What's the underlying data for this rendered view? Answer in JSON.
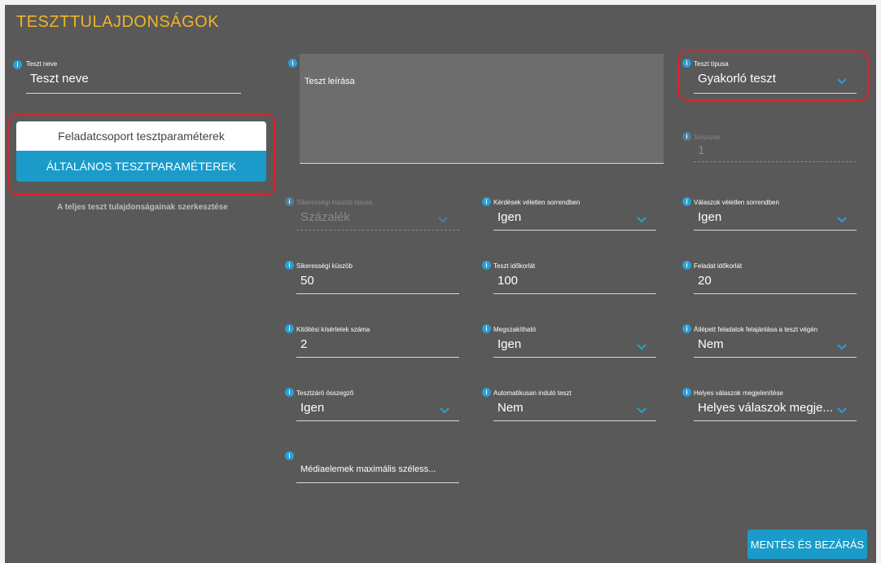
{
  "page": {
    "title": "TESZTTULAJDONSÁGOK"
  },
  "left": {
    "name_label": "Teszt neve",
    "name_value": "Teszt neve",
    "btn_group_params": "Feladatcsoport tesztparaméterek",
    "btn_general_params": "ÁLTALÁNOS TESZTPARAMÉTEREK",
    "caption": "A teljes teszt tulajdonságainak szerkesztése"
  },
  "description": {
    "placeholder": "Teszt leírása"
  },
  "type": {
    "label": "Teszt típusa",
    "value": "Gyakorló teszt"
  },
  "weight": {
    "label": "Súlyozás",
    "value": "1"
  },
  "fields": {
    "threshold_type": {
      "label": "Sikerességi küszöb típusa",
      "value": "Százalék"
    },
    "random_questions": {
      "label": "Kérdések véletlen sorrendben",
      "value": "Igen"
    },
    "random_answers": {
      "label": "Válaszok véletlen sorrendben",
      "value": "Igen"
    },
    "threshold": {
      "label": "Sikerességi küszöb",
      "value": "50"
    },
    "time_limit": {
      "label": "Teszt időkorlát",
      "value": "100"
    },
    "task_time_limit": {
      "label": "Feladat időkorlát",
      "value": "20"
    },
    "attempts": {
      "label": "Kitöltési kísérletek száma",
      "value": "2"
    },
    "interruptible": {
      "label": "Megszakítható",
      "value": "Igen"
    },
    "skipped_tasks": {
      "label": "Átlépett feladatok felajánlása a teszt végén",
      "value": "Nem"
    },
    "summary": {
      "label": "Tesztzáró összegző",
      "value": "Igen"
    },
    "autostart": {
      "label": "Automatikusan induló teszt",
      "value": "Nem"
    },
    "show_correct": {
      "label": "Helyes válaszok megjelenítése",
      "value": "Helyes válaszok megje..."
    },
    "media_width": {
      "label": "",
      "value": "Médiaelemek maximális széless..."
    }
  },
  "save_button": "MENTÉS ÉS BEZÁRÁS",
  "colors": {
    "accent": "#1a9bc9",
    "title": "#f0b429",
    "highlight": "#e0222a",
    "panel": "#595959"
  }
}
